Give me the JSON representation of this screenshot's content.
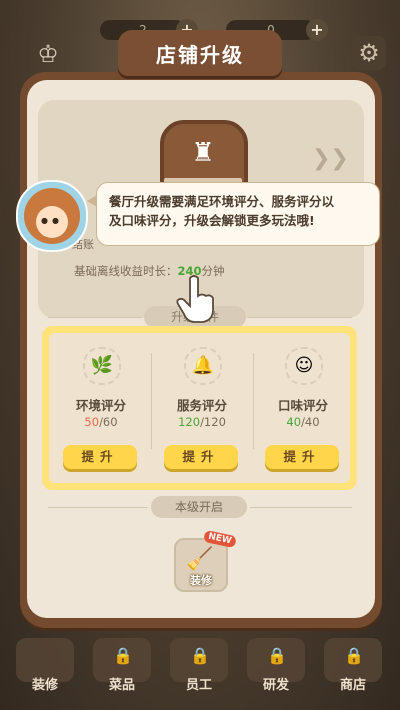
{
  "hud": {
    "coin_text": "2",
    "gem_text": "0",
    "plus_label": "+",
    "settings_icon": "gear-icon",
    "chef_icon": "chef-hat-icon"
  },
  "modal": {
    "title": "店铺升级",
    "offline_label": "基础离线收益时长：",
    "offline_value": "240",
    "offline_unit": "分钟",
    "linked_prefix": "结账",
    "conditions_header": "升级条件",
    "unlock_header": "本级开启"
  },
  "tooltip": {
    "line1": "餐厅升级需要满足环境评分、服务评分以",
    "line2": "及口味评分，升级会解锁更多玩法哦!"
  },
  "conditions": [
    {
      "name": "环境评分",
      "current": "50",
      "max": "/60",
      "current_color": "#e5684a",
      "icon": "leaf-icon",
      "button": "提升"
    },
    {
      "name": "服务评分",
      "current": "120",
      "max": "/120",
      "current_color": "#49a636",
      "icon": "bell-icon",
      "button": "提升"
    },
    {
      "name": "口味评分",
      "current": "40",
      "max": "/40",
      "current_color": "#49a636",
      "icon": "smile-face-icon",
      "button": "提升"
    }
  ],
  "unlock": {
    "label": "装修",
    "badge": "NEW",
    "icon": "paint-bucket-icon"
  },
  "nav": [
    {
      "label": "装修"
    },
    {
      "label": "菜品"
    },
    {
      "label": "员工"
    },
    {
      "label": "研发"
    },
    {
      "label": "商店"
    }
  ],
  "colors": {
    "panel_highlight": "#ffe37a",
    "button_yellow": "#ffd54a",
    "frame_brown": "#754b30"
  }
}
